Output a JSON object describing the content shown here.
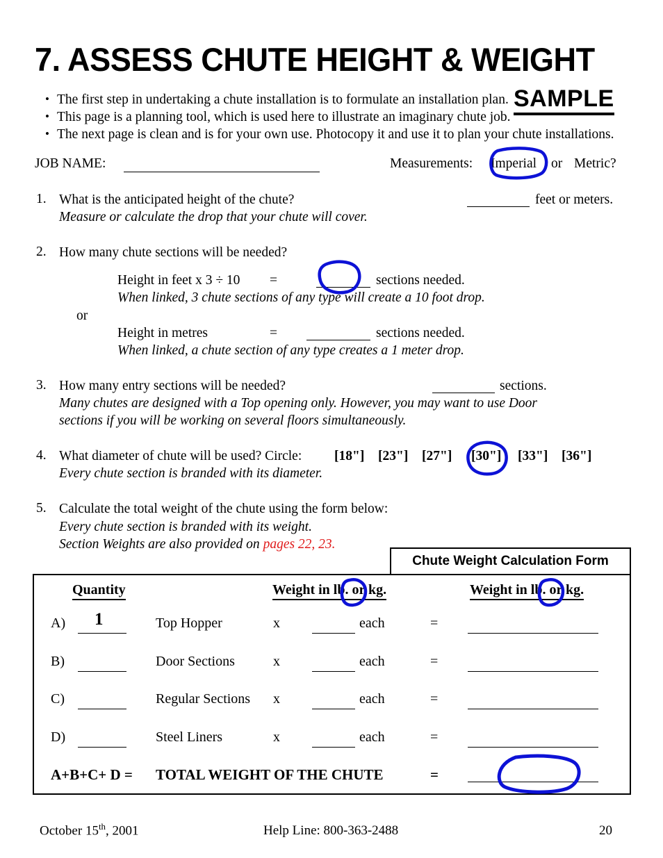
{
  "document": {
    "title": "7. ASSESS CHUTE HEIGHT & WEIGHT",
    "sample_stamp": "SAMPLE",
    "bullets": [
      "The first step in undertaking a chute installation is to formulate an installation plan.",
      "This page is a planning tool, which is used here to illustrate an imaginary chute job.",
      "The next page is clean and is for your own use.  Photocopy it and use it to plan your chute installations."
    ],
    "job_line": {
      "job_name_label": "JOB NAME:",
      "measurements_label": "Measurements:",
      "option_imperial": "Imperial",
      "option_or": "or",
      "option_metric": "Metric?"
    },
    "questions": [
      {
        "number": "1.",
        "text": "What is the anticipated height of the chute?",
        "answer_suffix": "feet or meters.",
        "note": "Measure or calculate the drop that your chute will cover."
      },
      {
        "number": "2.",
        "text": "How many chute sections will be needed?",
        "formula_imperial_label": "Height in feet x 3 ÷ 10",
        "formula_equals": "=",
        "formula_imperial_suffix": "sections needed.",
        "formula_imperial_note": "When linked, 3 chute sections of any type will create a 10 foot drop.",
        "or_label": "or",
        "formula_metric_label": "Height in metres",
        "formula_metric_suffix": "sections needed.",
        "formula_metric_note": "When linked, a chute section of any type creates a 1 meter drop."
      },
      {
        "number": "3.",
        "text": "How many entry sections will be needed?",
        "answer_suffix": "sections.",
        "note_line1": "Many chutes are designed with a Top opening only.  However, you may want to use Door",
        "note_line2": "sections if you will be working on several floors simultaneously."
      },
      {
        "number": "4.",
        "text": "What diameter of chute will be used? Circle:",
        "options": [
          "[18\"]",
          "[23\"]",
          "[27\"]",
          "[30\"]",
          "[33\"]",
          "[36\"]"
        ],
        "note": "Every chute section is branded with its diameter."
      },
      {
        "number": "5.",
        "text": "Calculate the total weight of the chute using the form below:",
        "note1": "Every chute section is branded with its weight.",
        "note2_prefix": "Section Weights are also provided on ",
        "note2_link": "pages 22, 23."
      }
    ],
    "form": {
      "header": "Chute Weight Calculation Form",
      "columns": [
        "Quantity",
        "Weight in lb. or kg.",
        "Weight in lb. or kg."
      ],
      "rows": [
        {
          "label": "A)",
          "quantity": "1",
          "item": "Top Hopper",
          "multiply": "x",
          "each": "each",
          "equals": "="
        },
        {
          "label": "B)",
          "quantity": "",
          "item": "Door Sections",
          "multiply": "x",
          "each": "each",
          "equals": "="
        },
        {
          "label": "C)",
          "quantity": "",
          "item": "Regular Sections",
          "multiply": "x",
          "each": "each",
          "equals": "="
        },
        {
          "label": "D)",
          "quantity": "",
          "item": "Steel Liners",
          "multiply": "x",
          "each": "each",
          "equals": "="
        }
      ],
      "total": {
        "formula": "A+B+C+ D  =",
        "label": "TOTAL WEIGHT OF THE CHUTE",
        "equals": "="
      }
    },
    "footer": {
      "date_prefix": "October 15",
      "date_sup": "th",
      "date_suffix": ", 2001",
      "help_line": "Help Line: 800-363-2488",
      "page_number": "20"
    },
    "annotations": {
      "color": "#0d12d6",
      "marks": [
        {
          "name": "circle-imperial",
          "target": "Imperial"
        },
        {
          "name": "circle-sections-blank",
          "target": "sections needed blank (imperial)"
        },
        {
          "name": "circle-30-inch",
          "target": "[30\"]"
        },
        {
          "name": "circle-lb-col2",
          "target": "lb. in Weight in lb. or kg. (column 2)"
        },
        {
          "name": "circle-lb-col3",
          "target": "lb. in Weight in lb. or kg. (column 3)"
        },
        {
          "name": "circle-total-blank",
          "target": "total weight blank"
        }
      ]
    }
  }
}
